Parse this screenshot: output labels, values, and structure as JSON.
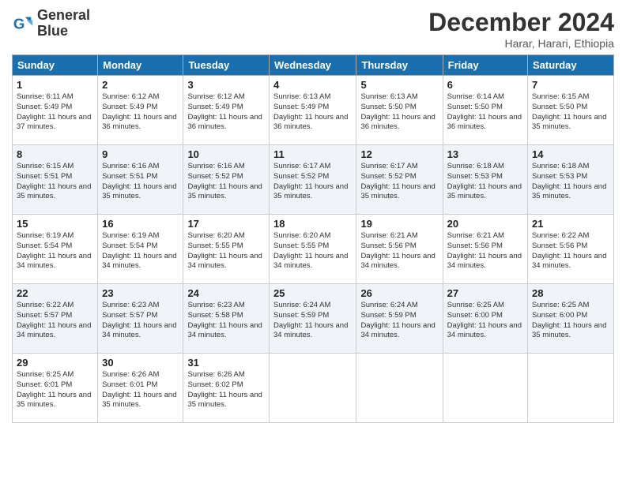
{
  "logo": {
    "line1": "General",
    "line2": "Blue"
  },
  "title": "December 2024",
  "subtitle": "Harar, Harari, Ethiopia",
  "weekdays": [
    "Sunday",
    "Monday",
    "Tuesday",
    "Wednesday",
    "Thursday",
    "Friday",
    "Saturday"
  ],
  "weeks": [
    [
      {
        "day": "1",
        "rise": "6:11 AM",
        "set": "5:49 PM",
        "daylight": "11 hours and 37 minutes."
      },
      {
        "day": "2",
        "rise": "6:12 AM",
        "set": "5:49 PM",
        "daylight": "11 hours and 36 minutes."
      },
      {
        "day": "3",
        "rise": "6:12 AM",
        "set": "5:49 PM",
        "daylight": "11 hours and 36 minutes."
      },
      {
        "day": "4",
        "rise": "6:13 AM",
        "set": "5:49 PM",
        "daylight": "11 hours and 36 minutes."
      },
      {
        "day": "5",
        "rise": "6:13 AM",
        "set": "5:50 PM",
        "daylight": "11 hours and 36 minutes."
      },
      {
        "day": "6",
        "rise": "6:14 AM",
        "set": "5:50 PM",
        "daylight": "11 hours and 36 minutes."
      },
      {
        "day": "7",
        "rise": "6:15 AM",
        "set": "5:50 PM",
        "daylight": "11 hours and 35 minutes."
      }
    ],
    [
      {
        "day": "8",
        "rise": "6:15 AM",
        "set": "5:51 PM",
        "daylight": "11 hours and 35 minutes."
      },
      {
        "day": "9",
        "rise": "6:16 AM",
        "set": "5:51 PM",
        "daylight": "11 hours and 35 minutes."
      },
      {
        "day": "10",
        "rise": "6:16 AM",
        "set": "5:52 PM",
        "daylight": "11 hours and 35 minutes."
      },
      {
        "day": "11",
        "rise": "6:17 AM",
        "set": "5:52 PM",
        "daylight": "11 hours and 35 minutes."
      },
      {
        "day": "12",
        "rise": "6:17 AM",
        "set": "5:52 PM",
        "daylight": "11 hours and 35 minutes."
      },
      {
        "day": "13",
        "rise": "6:18 AM",
        "set": "5:53 PM",
        "daylight": "11 hours and 35 minutes."
      },
      {
        "day": "14",
        "rise": "6:18 AM",
        "set": "5:53 PM",
        "daylight": "11 hours and 35 minutes."
      }
    ],
    [
      {
        "day": "15",
        "rise": "6:19 AM",
        "set": "5:54 PM",
        "daylight": "11 hours and 34 minutes."
      },
      {
        "day": "16",
        "rise": "6:19 AM",
        "set": "5:54 PM",
        "daylight": "11 hours and 34 minutes."
      },
      {
        "day": "17",
        "rise": "6:20 AM",
        "set": "5:55 PM",
        "daylight": "11 hours and 34 minutes."
      },
      {
        "day": "18",
        "rise": "6:20 AM",
        "set": "5:55 PM",
        "daylight": "11 hours and 34 minutes."
      },
      {
        "day": "19",
        "rise": "6:21 AM",
        "set": "5:56 PM",
        "daylight": "11 hours and 34 minutes."
      },
      {
        "day": "20",
        "rise": "6:21 AM",
        "set": "5:56 PM",
        "daylight": "11 hours and 34 minutes."
      },
      {
        "day": "21",
        "rise": "6:22 AM",
        "set": "5:56 PM",
        "daylight": "11 hours and 34 minutes."
      }
    ],
    [
      {
        "day": "22",
        "rise": "6:22 AM",
        "set": "5:57 PM",
        "daylight": "11 hours and 34 minutes."
      },
      {
        "day": "23",
        "rise": "6:23 AM",
        "set": "5:57 PM",
        "daylight": "11 hours and 34 minutes."
      },
      {
        "day": "24",
        "rise": "6:23 AM",
        "set": "5:58 PM",
        "daylight": "11 hours and 34 minutes."
      },
      {
        "day": "25",
        "rise": "6:24 AM",
        "set": "5:59 PM",
        "daylight": "11 hours and 34 minutes."
      },
      {
        "day": "26",
        "rise": "6:24 AM",
        "set": "5:59 PM",
        "daylight": "11 hours and 34 minutes."
      },
      {
        "day": "27",
        "rise": "6:25 AM",
        "set": "6:00 PM",
        "daylight": "11 hours and 34 minutes."
      },
      {
        "day": "28",
        "rise": "6:25 AM",
        "set": "6:00 PM",
        "daylight": "11 hours and 35 minutes."
      }
    ],
    [
      {
        "day": "29",
        "rise": "6:25 AM",
        "set": "6:01 PM",
        "daylight": "11 hours and 35 minutes."
      },
      {
        "day": "30",
        "rise": "6:26 AM",
        "set": "6:01 PM",
        "daylight": "11 hours and 35 minutes."
      },
      {
        "day": "31",
        "rise": "6:26 AM",
        "set": "6:02 PM",
        "daylight": "11 hours and 35 minutes."
      },
      null,
      null,
      null,
      null
    ]
  ]
}
